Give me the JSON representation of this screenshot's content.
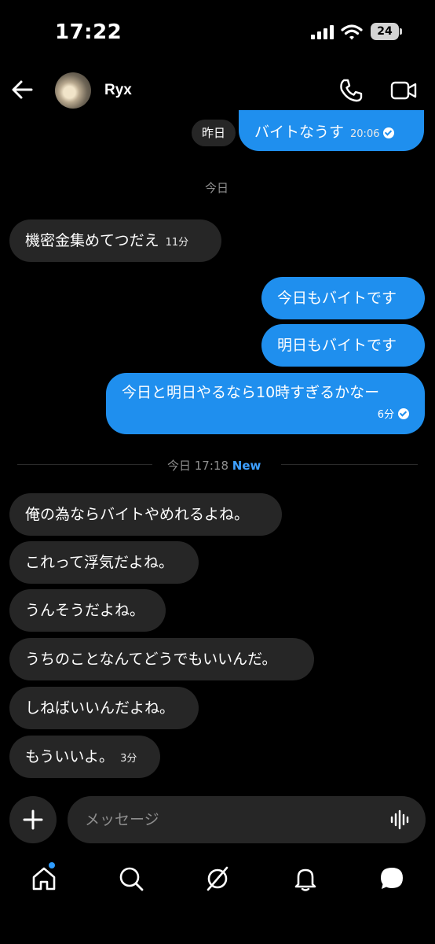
{
  "status": {
    "time": "17:22",
    "battery": "24"
  },
  "header": {
    "contact_name": "Ryx"
  },
  "dividers": {
    "yesterday": "昨日",
    "today": "今日",
    "today_new_time": "今日 17:18",
    "new_label": "New"
  },
  "messages": [
    {
      "dir": "out",
      "text": "バイトなうす",
      "time": "20:06",
      "read": true
    },
    {
      "dir": "in",
      "text": "機密金集めてつだえ",
      "time": "11分"
    },
    {
      "dir": "out",
      "text": "今日もバイトです"
    },
    {
      "dir": "out",
      "text": "明日もバイトです"
    },
    {
      "dir": "out",
      "text": "今日と明日やるなら10時すぎるかなー",
      "time": "6分",
      "read": true
    },
    {
      "dir": "in",
      "text": "俺の為ならバイトやめれるよね。"
    },
    {
      "dir": "in",
      "text": "これって浮気だよね。"
    },
    {
      "dir": "in",
      "text": "うんそうだよね。"
    },
    {
      "dir": "in",
      "text": "うちのことなんてどうでもいいんだ。"
    },
    {
      "dir": "in",
      "text": "しねばいいんだよね。"
    },
    {
      "dir": "in",
      "text": "もういいよ。",
      "time": "3分"
    }
  ],
  "composer": {
    "placeholder": "メッセージ"
  },
  "nav": {
    "items": [
      "home-icon",
      "search-icon",
      "explore-icon",
      "notifications-icon",
      "messages-icon"
    ],
    "home_has_badge": true
  },
  "colors": {
    "outgoing": "#1f8fee",
    "incoming": "#262626",
    "accent": "#3ea0ff"
  }
}
